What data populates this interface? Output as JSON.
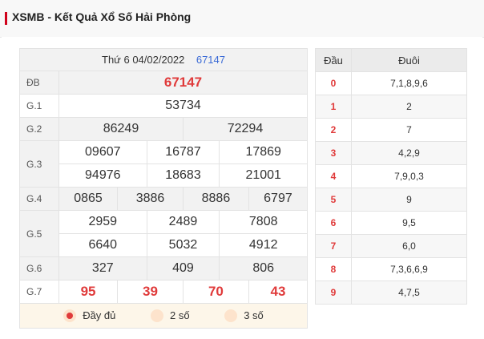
{
  "header": {
    "title": "XSMB - Kết Quả Xổ Số Hải Phòng"
  },
  "results": {
    "date": "Thứ 6 04/02/2022",
    "draw_id": "67147",
    "labels": {
      "db": "ĐB",
      "g1": "G.1",
      "g2": "G.2",
      "g3": "G.3",
      "g4": "G.4",
      "g5": "G.5",
      "g6": "G.6",
      "g7": "G.7"
    },
    "db": "67147",
    "g1": "53734",
    "g2": [
      "86249",
      "72294"
    ],
    "g3": [
      "09607",
      "16787",
      "17869",
      "94976",
      "18683",
      "21001"
    ],
    "g4": [
      "0865",
      "3886",
      "8886",
      "6797"
    ],
    "g5": [
      "2959",
      "2489",
      "7808",
      "6640",
      "5032",
      "4912"
    ],
    "g6": [
      "327",
      "409",
      "806"
    ],
    "g7": [
      "95",
      "39",
      "70",
      "43"
    ],
    "options": [
      "Đầy đủ",
      "2 số",
      "3 số"
    ]
  },
  "loto": {
    "head_label": "Đầu",
    "tail_label": "Đuôi",
    "rows": [
      {
        "head": "0",
        "tails": "7,1,8,9,6"
      },
      {
        "head": "1",
        "tails": "2"
      },
      {
        "head": "2",
        "tails": "7"
      },
      {
        "head": "3",
        "tails": "4,2,9"
      },
      {
        "head": "4",
        "tails": "7,9,0,3"
      },
      {
        "head": "5",
        "tails": "9"
      },
      {
        "head": "6",
        "tails": "9,5"
      },
      {
        "head": "7",
        "tails": "6,0"
      },
      {
        "head": "8",
        "tails": "7,3,6,6,9"
      },
      {
        "head": "9",
        "tails": "4,7,5"
      }
    ]
  },
  "colors": {
    "accent": "#e03b3b",
    "link": "#3a6ad6",
    "brand_bar": "#d0021b"
  }
}
